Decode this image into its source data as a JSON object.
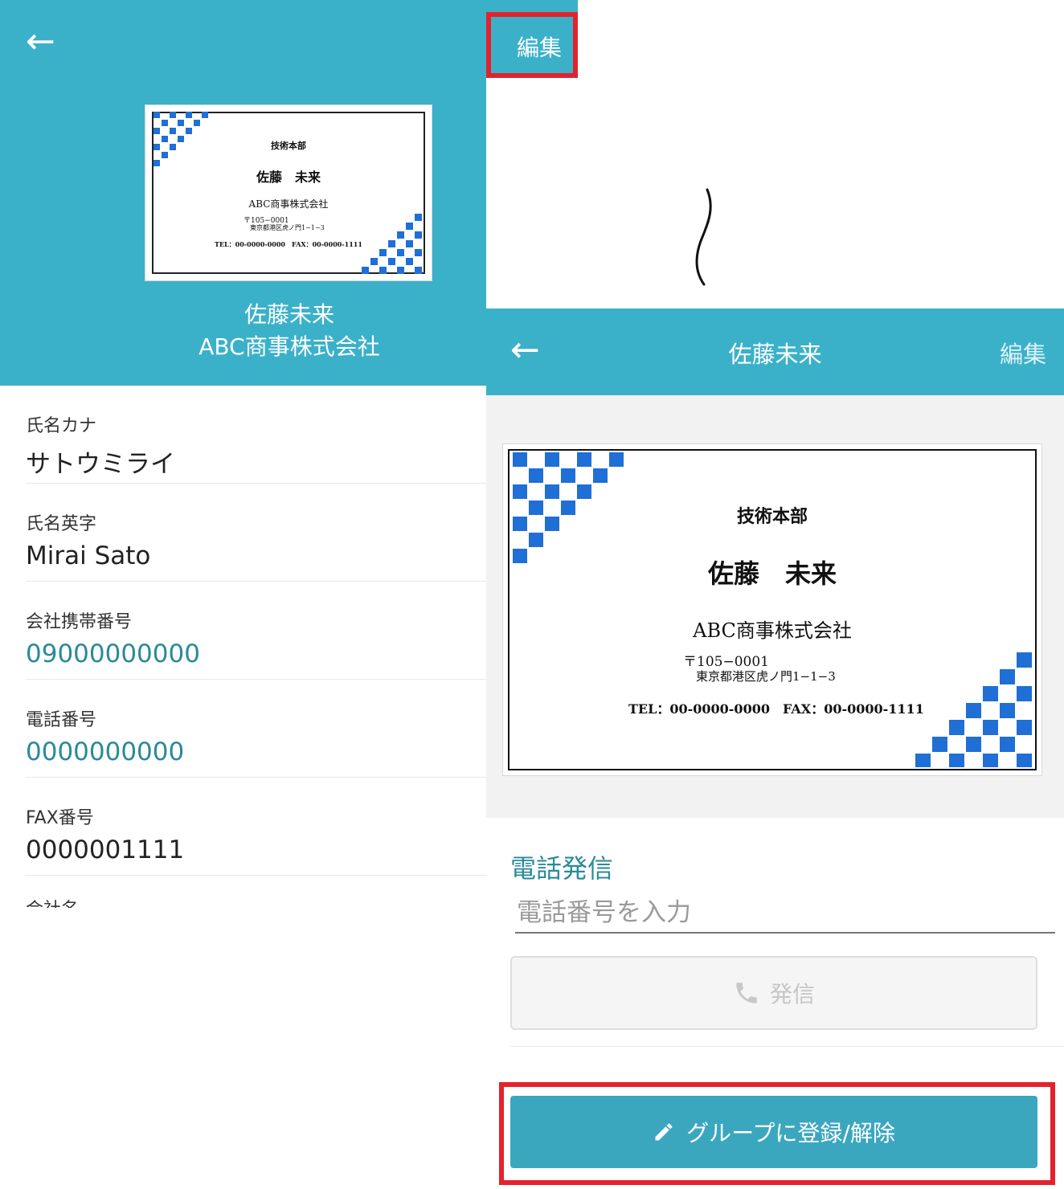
{
  "left": {
    "back_icon": "back-arrow-icon",
    "edit_label": "編集",
    "card": {
      "department": "技術本部",
      "person": "佐藤　未来",
      "company": "ABC商事株式会社",
      "postal": "〒105−0001",
      "address": "東京都港区虎ノ門1−1−3",
      "contact": "TEL：00-0000-0000　FAX：00-0000-1111"
    },
    "person_name": "佐藤未来",
    "company_name": "ABC商事株式会社",
    "fields": [
      {
        "label": "氏名カナ",
        "value": "サトウミライ"
      },
      {
        "label": "氏名英字",
        "value": "Mirai Sato"
      },
      {
        "label": "会社携帯番号",
        "value": "09000000000"
      },
      {
        "label": "電話番号",
        "value": "0000000000"
      },
      {
        "label": "FAX番号",
        "value": "0000001111"
      }
    ],
    "partial_field_label": "会社名"
  },
  "right": {
    "back_icon": "back-arrow-icon",
    "title": "佐藤未来",
    "edit_label": "編集",
    "card": {
      "department": "技術本部",
      "person": "佐藤　未来",
      "company": "ABC商事株式会社",
      "postal": "〒105−0001",
      "address": "東京都港区虎ノ門1−1−3",
      "contact": "TEL：00-0000-0000　FAX：00-0000-1111"
    },
    "call_section_title": "電話発信",
    "phone_placeholder": "電話番号を入力",
    "dial_button_label": "発信",
    "dial_icon": "phone-icon",
    "group_button_label": "グループに登録/解除",
    "group_icon": "pencil-icon"
  },
  "colors": {
    "header": "#3bb1c9",
    "accent_text": "#2a8a99",
    "highlight": "#e4222d",
    "card_blue": "#1f6fd6"
  }
}
